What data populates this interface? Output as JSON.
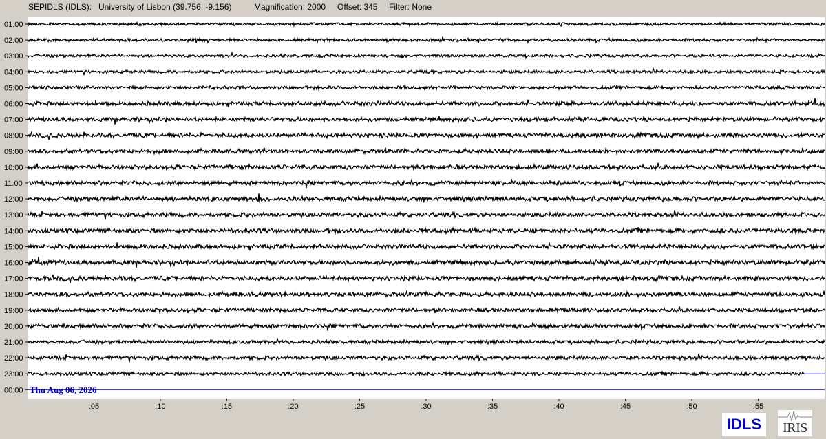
{
  "header": {
    "station": "SEPIDLS (IDLS):",
    "location": "University of Lisbon (39.756, -9.156)",
    "magnification": "Magnification: 2000",
    "offset": "Offset: 345",
    "filter": "Filter: None"
  },
  "date_label": "Thu Aug 06, 2026",
  "colors": {
    "trace": "#000000",
    "current_trace": "#0000cc",
    "background": "#ffffff",
    "frame": "#d4d0c8",
    "date_text": "#0000cc"
  },
  "logos": {
    "idls": "IDLS",
    "iris": "IRIS"
  },
  "chart_data": {
    "type": "line",
    "title": "",
    "xlabel": "",
    "ylabel": "",
    "x_unit": "minutes past the hour",
    "x_ticks": [
      ":05",
      ":10",
      ":15",
      ":20",
      ":25",
      ":30",
      ":35",
      ":40",
      ":45",
      ":50",
      ":55"
    ],
    "x_tick_values": [
      5,
      10,
      15,
      20,
      25,
      30,
      35,
      40,
      45,
      50,
      55
    ],
    "xlim": [
      0,
      60
    ],
    "row_labels": [
      "01:00",
      "02:00",
      "03:00",
      "04:00",
      "05:00",
      "06:00",
      "07:00",
      "08:00",
      "09:00",
      "10:00",
      "11:00",
      "12:00",
      "13:00",
      "14:00",
      "15:00",
      "16:00",
      "17:00",
      "18:00",
      "19:00",
      "20:00",
      "21:00",
      "22:00",
      "23:00",
      "00:00"
    ],
    "series": [
      {
        "row": "01:00",
        "noise_level": 0.35,
        "end_minute": 60
      },
      {
        "row": "02:00",
        "noise_level": 0.45,
        "end_minute": 60
      },
      {
        "row": "03:00",
        "noise_level": 0.4,
        "end_minute": 60
      },
      {
        "row": "04:00",
        "noise_level": 0.4,
        "end_minute": 60
      },
      {
        "row": "05:00",
        "noise_level": 0.6,
        "end_minute": 60
      },
      {
        "row": "06:00",
        "noise_level": 0.8,
        "end_minute": 60
      },
      {
        "row": "07:00",
        "noise_level": 0.85,
        "end_minute": 60
      },
      {
        "row": "08:00",
        "noise_level": 0.85,
        "end_minute": 60
      },
      {
        "row": "09:00",
        "noise_level": 0.85,
        "end_minute": 60
      },
      {
        "row": "10:00",
        "noise_level": 0.9,
        "end_minute": 60
      },
      {
        "row": "11:00",
        "noise_level": 0.85,
        "end_minute": 60
      },
      {
        "row": "12:00",
        "noise_level": 0.85,
        "end_minute": 60,
        "events": [
          {
            "minute": 17.4,
            "amplitude": 2.2
          }
        ]
      },
      {
        "row": "13:00",
        "noise_level": 0.85,
        "end_minute": 60
      },
      {
        "row": "14:00",
        "noise_level": 0.95,
        "end_minute": 60
      },
      {
        "row": "15:00",
        "noise_level": 0.9,
        "end_minute": 60
      },
      {
        "row": "16:00",
        "noise_level": 0.9,
        "end_minute": 60
      },
      {
        "row": "17:00",
        "noise_level": 0.95,
        "end_minute": 60
      },
      {
        "row": "18:00",
        "noise_level": 0.85,
        "end_minute": 60
      },
      {
        "row": "19:00",
        "noise_level": 0.8,
        "end_minute": 60
      },
      {
        "row": "20:00",
        "noise_level": 0.75,
        "end_minute": 60
      },
      {
        "row": "21:00",
        "noise_level": 0.65,
        "end_minute": 60
      },
      {
        "row": "22:00",
        "noise_level": 0.7,
        "end_minute": 60
      },
      {
        "row": "23:00",
        "noise_level": 0.6,
        "end_minute": 58.5
      },
      {
        "row": "00:00",
        "noise_level": 0.0,
        "end_minute": 0
      }
    ],
    "grid": false
  }
}
